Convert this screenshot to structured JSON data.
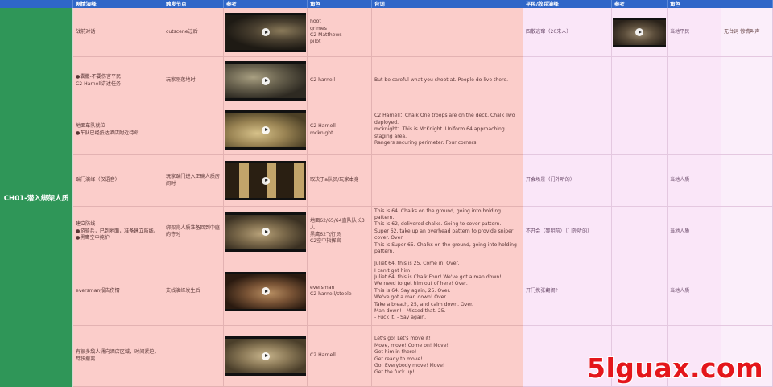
{
  "headers": {
    "chapter": "",
    "plot": "剧情演绎",
    "trigger": "触发节点",
    "reference": "参考",
    "role": "角色",
    "dialogue": "台词",
    "civilian": "平民/敌兵演绎",
    "reference2": "参考",
    "role2": "角色",
    "dialogue2": ""
  },
  "chapter_title": "CH01-潜入绑架人质",
  "rows": [
    {
      "plot": "战前对话",
      "trigger": "cutscene过后",
      "role": "hoot\ngrimes\nC2 Matthews\npilot",
      "dialogue": "",
      "civilian": "四散逃窜（20来人）",
      "role2": "当地平民",
      "dialogue2": "无台词 惊慌叫声",
      "thumb": "soldier-closeup",
      "thumb2": "crowd-scene"
    },
    {
      "plot": "●囊撒-不要伤害平民\nC2 Harnell讲述任务",
      "trigger": "玩家刚落地时",
      "role": "C2 harnell",
      "dialogue": "But be careful what you shoot at. People do live there.",
      "civilian": "",
      "role2": "",
      "dialogue2": "",
      "thumb": "soldier-helmet"
    },
    {
      "plot": "地面车队就位\n●车队已经抵达酒店附近待命",
      "trigger": "",
      "role": "C2 Harnell\nmcknight",
      "dialogue": "C2 Harnell：Chalk One troops are on the deck. Chalk Two deployed.\nmcknight：This is McKnight. Uniform 64 approaching staging area.\nRangers securing perimeter. Four corners.",
      "civilian": "",
      "role2": "",
      "dialogue2": "",
      "thumb": "dust-street"
    },
    {
      "plot": "踹门演绎（仅语音）",
      "trigger": "玩家踹门进入正确人质房间时",
      "role": "取决于a队员/玩家本身",
      "dialogue": "",
      "civilian": "开会场景（门外听的）",
      "role2": "当地人质",
      "dialogue2": "",
      "thumb": "arches"
    },
    {
      "plot": "建立防线\n●游骑兵，已到地面，准备建立防线。\n●黑鹰空中掩护",
      "trigger": "绑架完人质准备回到中庭的守时",
      "role": "地面62/65/64直队队长3人\n黑鹰62飞行员\nC2空中指挥官",
      "dialogue": "This is 64. Chalks on the ground, going into holding pattern.\nThis is 62, delivered chalks. Going to cover pattern.\nSuper 62, take up an overhead pattern to provide sniper cover. Over.\nThis is Super 65. Chalks on the ground, going into holding pattern.",
      "civilian": "不开会（黎明前）（门外听的）",
      "role2": "当地人质",
      "dialogue2": "",
      "thumb": "helicopter"
    },
    {
      "plot": "eversman报告伤情",
      "trigger": "支线演绎发生后",
      "role": "eversman\nC2 harnell/steele",
      "dialogue": "Juliet 64, this is 25. Come in. Over.\nI can't get him!\nJuliet 64, this is Chalk Four! We've got a man down!\nWe need to get him out of here! Over.\nThis is 64. Say again, 25. Over.\nWe've got a man down! Over.\nTake a breath, 25, and calm down. Over.\nMan down! - Missed that. 25.\n- Fuck it. - Say again.",
      "civilian": "开门携张翻闹?",
      "role2": "当地人质",
      "dialogue2": "",
      "thumb": "man-down"
    },
    {
      "plot": "有很多敌人涌向酒店区域，时间紧迫，尽快撤离",
      "trigger": "",
      "role": "C2 Harnell",
      "dialogue": "Let's go! Let's move it!\nMove, move! Come on! Move!\nGet him in there!\nGet ready to move!\nGo! Everybody move! Move!\nGet the fuck up!",
      "civilian": "",
      "role2": "",
      "dialogue2": "",
      "thumb": "squad-move"
    }
  ],
  "watermark": "5lguax.com"
}
